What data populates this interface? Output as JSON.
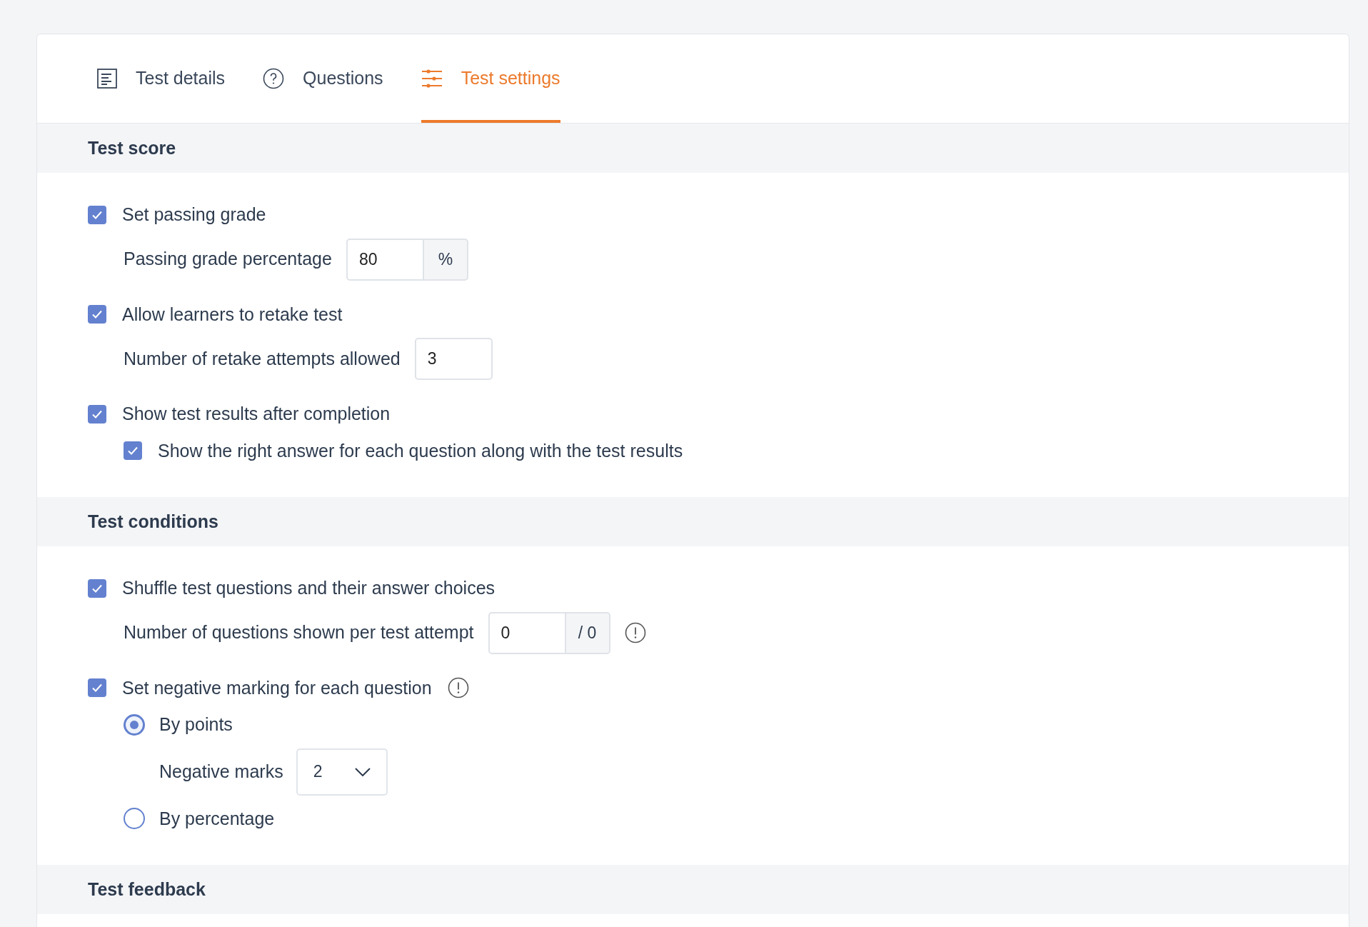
{
  "tabs": [
    {
      "label": "Test details",
      "selected": false
    },
    {
      "label": "Questions",
      "selected": false
    },
    {
      "label": "Test settings",
      "selected": true
    }
  ],
  "sections": [
    {
      "title": "Test score",
      "items": [
        {
          "kind": "checkbox",
          "label": "Set passing grade",
          "checked": true,
          "children": [
            {
              "kind": "field",
              "label": "Passing grade percentage",
              "value": "80",
              "addon": "%"
            }
          ]
        },
        {
          "kind": "checkbox",
          "label": "Allow learners to retake test",
          "checked": true,
          "children": [
            {
              "kind": "field",
              "label": "Number of retake attempts allowed",
              "value": "3"
            }
          ]
        },
        {
          "kind": "checkbox",
          "label": "Show test results after completion",
          "checked": true,
          "children": [
            {
              "kind": "checkbox",
              "label": "Show the right answer for each question along with the test results",
              "checked": true
            }
          ]
        }
      ]
    },
    {
      "title": "Test conditions",
      "items": [
        {
          "kind": "checkbox",
          "label": "Shuffle test questions and their answer choices",
          "checked": true,
          "children": [
            {
              "kind": "field",
              "label": "Number of questions shown per test attempt",
              "value": "0",
              "addon": "/ 0",
              "info": true
            }
          ]
        },
        {
          "kind": "checkbox",
          "label": "Set negative marking for each question",
          "checked": true,
          "info": true,
          "children": [
            {
              "kind": "radio",
              "label": "By points",
              "selected": true,
              "children": [
                {
                  "kind": "select",
                  "label": "Negative marks",
                  "value": "2"
                }
              ]
            },
            {
              "kind": "radio",
              "label": "By percentage",
              "selected": false
            }
          ]
        }
      ]
    },
    {
      "title": "Test feedback"
    }
  ]
}
